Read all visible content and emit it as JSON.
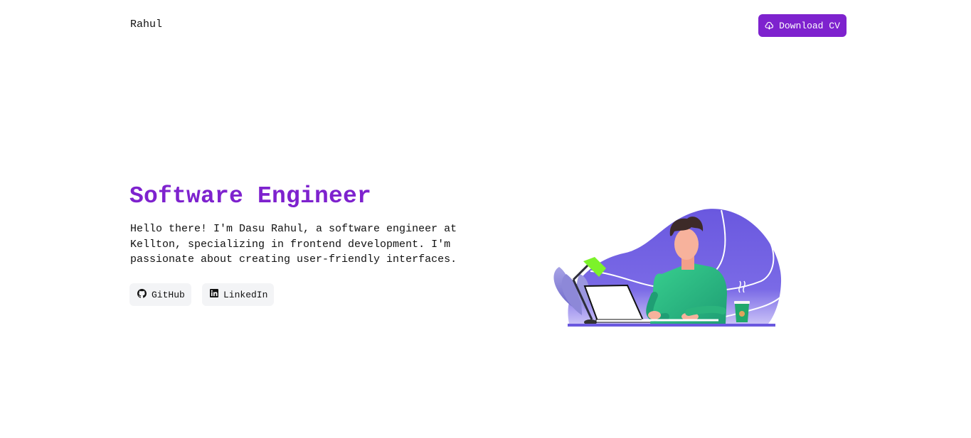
{
  "nav": {
    "brand": "Rahul",
    "download_label": "Download CV",
    "download_icon": "cloud-download-icon"
  },
  "hero": {
    "title": "Software Engineer",
    "intro": "Hello there! I'm Dasu Rahul, a software engineer at Kellton, specializing in frontend development. I'm passionate about creating user-friendly interfaces.",
    "links": [
      {
        "label": "GitHub",
        "icon": "github-icon"
      },
      {
        "label": "LinkedIn",
        "icon": "linkedin-icon"
      }
    ]
  },
  "illustration": {
    "subject": "developer-working-at-laptop",
    "colors": {
      "accent": "#7e22ce",
      "blob": "#6d5ce0",
      "shirt": "#2ec486",
      "lamp": "#7cf22a"
    }
  },
  "colors": {
    "accent": "#7e22ce",
    "button_bg": "#f3f4f6",
    "text": "#111111"
  }
}
